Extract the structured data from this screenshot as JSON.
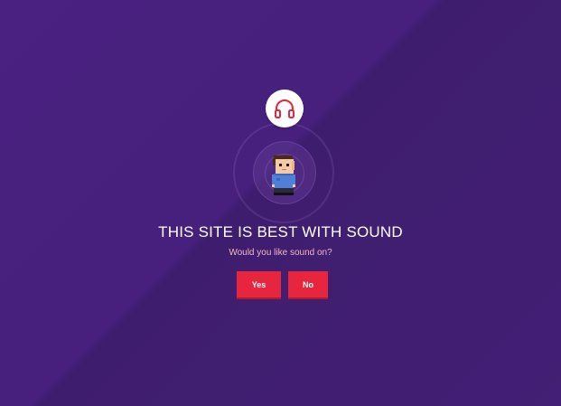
{
  "prompt": {
    "heading": "THIS SITE IS BEST WITH SOUND",
    "question": "Would you like sound on?",
    "yes_label": "Yes",
    "no_label": "No"
  },
  "icons": {
    "badge": "headphones-icon",
    "character": "pixel-character-icon"
  },
  "colors": {
    "background": "#45207a",
    "accent": "#e8253f",
    "subtitle": "#f3b8c6",
    "heading": "#ffffff"
  }
}
